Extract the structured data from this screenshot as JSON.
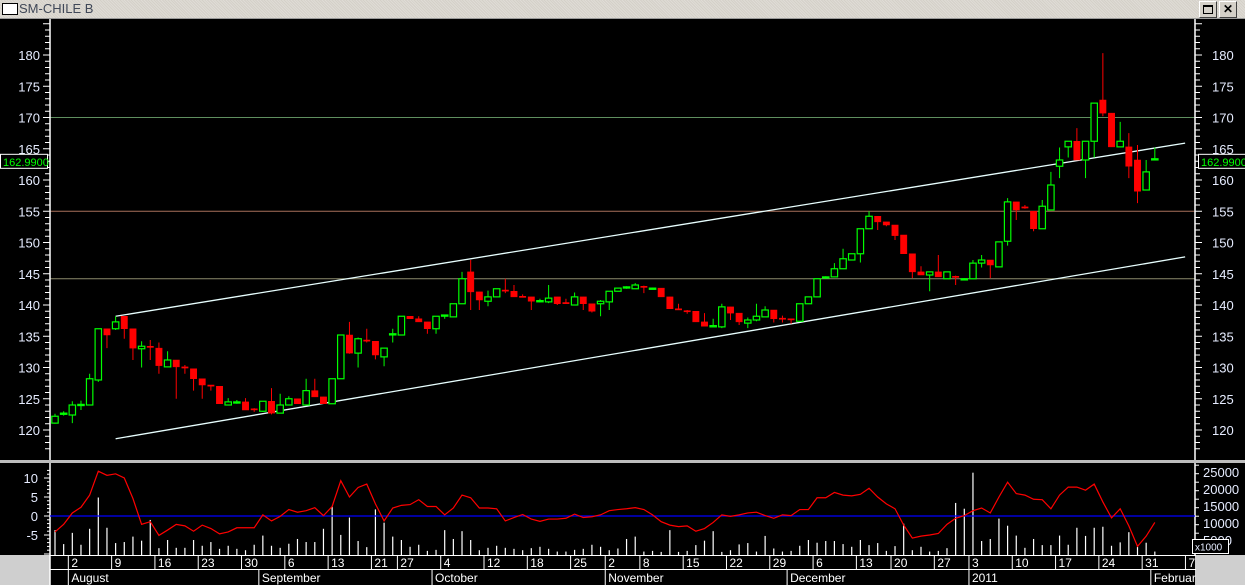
{
  "window": {
    "title": "SM-CHILE B",
    "restore_label": "restore",
    "close_label": "✕"
  },
  "last_price_label": "162.9900",
  "volume_multiplier_label": "x1000",
  "colors": {
    "up": "#00ff00",
    "down": "#ff0000",
    "oscillator": "#ff0000",
    "zero_line": "#0000ff",
    "volume": "#ffffff",
    "trendline": "#e8ffff",
    "axis_text": "#e6ecff"
  },
  "chart_data": [
    {
      "type": "candlestick",
      "title": "SM-CHILE B",
      "ylim": [
        116,
        186
      ],
      "yticks": [
        120,
        125,
        130,
        135,
        140,
        145,
        150,
        155,
        160,
        165,
        170,
        175,
        180
      ],
      "horizontal_lines": [
        {
          "value": 170,
          "color": "#5f8f5f"
        },
        {
          "value": 155,
          "color": "#a8705a"
        },
        {
          "value": 144.2,
          "color": "#8c8a6c"
        }
      ],
      "trendlines": [
        {
          "from": [
            7,
            138.2
          ],
          "to": [
            130.5,
            165.9
          ]
        },
        {
          "from": [
            7,
            118.6
          ],
          "to": [
            130.5,
            147.7
          ]
        }
      ],
      "ohlc": [
        [
          121.1,
          122.6,
          121.0,
          122.2
        ],
        [
          122.7,
          123.0,
          122.3,
          122.7
        ],
        [
          122.4,
          124.6,
          121.1,
          124.0
        ],
        [
          124.0,
          124.7,
          123.2,
          124.1
        ],
        [
          124.0,
          129.0,
          124.0,
          128.2
        ],
        [
          128.0,
          136.2,
          127.7,
          136.2
        ],
        [
          136.2,
          136.2,
          133.1,
          135.2
        ],
        [
          136.2,
          138.2,
          136.0,
          137.3
        ],
        [
          138.2,
          138.2,
          134.6,
          136.2
        ],
        [
          136.2,
          136.2,
          131.2,
          133.1
        ],
        [
          133.0,
          134.2,
          130.0,
          133.4
        ],
        [
          133.4,
          134.4,
          131.2,
          133.3
        ],
        [
          133.1,
          134.0,
          129.0,
          130.3
        ],
        [
          130.1,
          132.6,
          130.1,
          131.2
        ],
        [
          131.2,
          131.2,
          125.0,
          130.1
        ],
        [
          130.1,
          130.4,
          129.0,
          130.0
        ],
        [
          129.8,
          129.8,
          126.3,
          128.2
        ],
        [
          128.2,
          128.2,
          125.0,
          127.2
        ],
        [
          127.2,
          127.2,
          126.3,
          127.1
        ],
        [
          127.0,
          127.0,
          124.2,
          124.2
        ],
        [
          124.0,
          125.1,
          124.0,
          124.5
        ],
        [
          124.4,
          124.8,
          124.2,
          124.5
        ],
        [
          124.5,
          125.1,
          123.2,
          123.2
        ],
        [
          123.4,
          123.5,
          122.9,
          123.3
        ],
        [
          123.0,
          124.6,
          122.9,
          124.6
        ],
        [
          124.6,
          126.7,
          122.5,
          122.7
        ],
        [
          122.7,
          125.8,
          122.7,
          124.0
        ],
        [
          124.0,
          125.4,
          124.0,
          125.0
        ],
        [
          125.0,
          125.0,
          124.2,
          124.2
        ],
        [
          124.0,
          128.2,
          124.0,
          126.3
        ],
        [
          126.3,
          128.2,
          125.3,
          125.3
        ],
        [
          125.3,
          125.3,
          124.2,
          124.2
        ],
        [
          124.2,
          128.2,
          124.2,
          128.2
        ],
        [
          128.2,
          135.2,
          128.2,
          135.2
        ],
        [
          135.2,
          137.3,
          132.2,
          132.3
        ],
        [
          132.3,
          134.8,
          130.0,
          134.6
        ],
        [
          134.4,
          136.2,
          134.0,
          134.3
        ],
        [
          134.2,
          134.2,
          131.3,
          132.0
        ],
        [
          131.7,
          133.1,
          130.2,
          133.1
        ],
        [
          135.3,
          136.2,
          134.0,
          135.4
        ],
        [
          135.2,
          138.2,
          135.2,
          138.2
        ],
        [
          138.2,
          138.2,
          137.8,
          137.8
        ],
        [
          137.8,
          138.2,
          137.3,
          137.3
        ],
        [
          137.3,
          137.3,
          135.4,
          136.2
        ],
        [
          136.2,
          138.2,
          135.4,
          138.2
        ],
        [
          138.3,
          138.4,
          137.8,
          138.4
        ],
        [
          138.1,
          140.2,
          138.1,
          140.2
        ],
        [
          140.2,
          145.3,
          140.2,
          144.2
        ],
        [
          145.3,
          147.2,
          139.2,
          142.1
        ],
        [
          142.1,
          142.1,
          139.2,
          140.8
        ],
        [
          140.6,
          142.3,
          139.8,
          141.3
        ],
        [
          141.3,
          142.6,
          141.3,
          142.6
        ],
        [
          142.4,
          144.2,
          141.9,
          142.3
        ],
        [
          142.2,
          143.2,
          141.3,
          141.3
        ],
        [
          141.4,
          141.7,
          141.3,
          141.3
        ],
        [
          141.3,
          141.3,
          139.2,
          140.6
        ],
        [
          140.6,
          141.0,
          140.4,
          140.7
        ],
        [
          140.5,
          143.2,
          140.3,
          141.1
        ],
        [
          141.3,
          141.3,
          140.0,
          140.2
        ],
        [
          140.4,
          141.0,
          140.2,
          140.3
        ],
        [
          140.0,
          142.0,
          140.0,
          141.3
        ],
        [
          141.3,
          141.3,
          139.2,
          140.2
        ],
        [
          140.2,
          140.2,
          138.8,
          139.0
        ],
        [
          140.2,
          140.8,
          138.2,
          140.6
        ],
        [
          140.5,
          142.2,
          139.2,
          142.2
        ],
        [
          142.2,
          142.7,
          142.2,
          142.7
        ],
        [
          142.8,
          143.0,
          142.6,
          142.9
        ],
        [
          142.6,
          143.5,
          142.6,
          143.2
        ],
        [
          143.0,
          143.1,
          141.9,
          142.9
        ],
        [
          142.7,
          142.8,
          142.6,
          142.7
        ],
        [
          142.7,
          142.7,
          141.3,
          141.3
        ],
        [
          141.3,
          141.3,
          139.4,
          139.4
        ],
        [
          139.4,
          140.2,
          139.2,
          139.3
        ],
        [
          139.1,
          139.2,
          138.6,
          139.0
        ],
        [
          139.0,
          139.0,
          137.3,
          137.3
        ],
        [
          137.3,
          138.7,
          136.6,
          136.6
        ],
        [
          136.5,
          137.8,
          136.5,
          136.7
        ],
        [
          136.5,
          140.2,
          136.3,
          139.7
        ],
        [
          139.7,
          139.7,
          137.6,
          138.7
        ],
        [
          138.7,
          138.7,
          136.8,
          137.3
        ],
        [
          137.1,
          138.0,
          136.3,
          137.6
        ],
        [
          137.6,
          140.2,
          137.4,
          138.2
        ],
        [
          138.1,
          139.8,
          138.1,
          139.2
        ],
        [
          139.2,
          139.2,
          137.2,
          137.8
        ],
        [
          137.9,
          138.3,
          137.2,
          137.8
        ],
        [
          137.8,
          137.8,
          137.0,
          137.7
        ],
        [
          137.4,
          140.2,
          137.4,
          140.2
        ],
        [
          140.2,
          141.3,
          140.2,
          141.3
        ],
        [
          141.3,
          144.2,
          141.3,
          144.2
        ],
        [
          144.4,
          144.6,
          144.3,
          144.5
        ],
        [
          144.5,
          146.7,
          144.5,
          145.8
        ],
        [
          145.8,
          149.0,
          145.8,
          147.4
        ],
        [
          147.2,
          148.2,
          147.2,
          148.2
        ],
        [
          148.2,
          152.2,
          146.8,
          152.2
        ],
        [
          152.2,
          155.0,
          152.2,
          154.2
        ],
        [
          154.2,
          154.2,
          152.0,
          153.3
        ],
        [
          153.3,
          153.3,
          152.6,
          152.8
        ],
        [
          152.8,
          152.8,
          150.4,
          151.1
        ],
        [
          151.2,
          151.2,
          148.2,
          148.2
        ],
        [
          148.2,
          148.2,
          144.3,
          145.3
        ],
        [
          145.3,
          146.2,
          144.8,
          144.8
        ],
        [
          144.8,
          145.3,
          142.2,
          145.3
        ],
        [
          145.3,
          148.0,
          144.5,
          144.5
        ],
        [
          144.2,
          145.3,
          144.2,
          145.3
        ],
        [
          144.6,
          144.7,
          143.2,
          144.5
        ],
        [
          144.2,
          144.3,
          144.1,
          144.2
        ],
        [
          144.2,
          147.2,
          144.2,
          146.7
        ],
        [
          146.7,
          148.0,
          146.0,
          147.2
        ],
        [
          147.2,
          147.2,
          144.3,
          146.4
        ],
        [
          146.1,
          150.1,
          146.1,
          150.1
        ],
        [
          150.2,
          157.1,
          149.5,
          156.5
        ],
        [
          156.5,
          156.5,
          153.6,
          155.2
        ],
        [
          155.7,
          156.0,
          155.4,
          155.6
        ],
        [
          155.0,
          155.0,
          151.8,
          152.2
        ],
        [
          152.2,
          156.8,
          152.2,
          155.8
        ],
        [
          155.2,
          161.3,
          155.2,
          159.2
        ],
        [
          162.2,
          165.2,
          160.3,
          163.2
        ],
        [
          165.3,
          166.2,
          163.6,
          166.2
        ],
        [
          166.2,
          168.3,
          163.2,
          163.2
        ],
        [
          163.2,
          166.2,
          160.3,
          166.2
        ],
        [
          166.2,
          172.3,
          163.6,
          172.3
        ],
        [
          172.8,
          180.3,
          170.2,
          170.7
        ],
        [
          170.7,
          170.7,
          165.3,
          165.3
        ],
        [
          165.3,
          169.3,
          165.3,
          166.2
        ],
        [
          165.3,
          167.5,
          160.3,
          162.2
        ],
        [
          163.2,
          165.6,
          156.3,
          158.2
        ],
        [
          158.4,
          163.2,
          158.4,
          161.3
        ],
        [
          163.4,
          165.2,
          163.4,
          163.4
        ]
      ]
    },
    {
      "type": "line+bar",
      "oscillator": {
        "ylim": [
          -10,
          14
        ],
        "yticks": [
          -5,
          0,
          5,
          10
        ],
        "values": [
          -4.2,
          -2.2,
          0.8,
          2.3,
          5.5,
          11.8,
          10.7,
          11.1,
          10,
          4.6,
          -2.2,
          -1.5,
          -5.1,
          -3.7,
          -2.2,
          -2.6,
          -4,
          -2.4,
          -3.3,
          -4.7,
          -4.2,
          -3.1,
          -3.1,
          -3.1,
          0.3,
          -1.3,
          -0.1,
          1.7,
          1,
          1.4,
          2.2,
          0.1,
          2.5,
          9.3,
          5,
          7.5,
          8.4,
          3.2,
          -1.3,
          2.1,
          2.8,
          3,
          4.3,
          2.5,
          2.5,
          0.3,
          2.1,
          5.5,
          4.8,
          2.1,
          2.1,
          1.9,
          -1.3,
          -0.4,
          0.4,
          -0.8,
          -1.4,
          -0.8,
          -0.8,
          -0.6,
          0.5,
          -0.4,
          -0.2,
          0.3,
          1.4,
          1.7,
          1.9,
          2.2,
          1.7,
          0.3,
          -1.5,
          -2.4,
          -2.8,
          -2.6,
          -4,
          -3.3,
          -1.7,
          0.3,
          -0.1,
          0.3,
          0.8,
          1,
          0.1,
          -0.6,
          0.3,
          0.1,
          1.7,
          1.7,
          4.8,
          4.8,
          6.2,
          5.5,
          5.3,
          5.7,
          7.3,
          5,
          3.2,
          1.9,
          -2.4,
          -5.8,
          -5.3,
          -5,
          -4.6,
          -2.2,
          -0.6,
          0.1,
          1.4,
          2.1,
          0.8,
          5,
          8.9,
          5.9,
          5.5,
          4.4,
          4.3,
          1.9,
          5.5,
          7.6,
          7.6,
          6.8,
          8.4,
          3.7,
          -0.5,
          1.9,
          -2.6,
          -8,
          -5.3,
          -1.7
        ]
      },
      "volume": {
        "unit": "x1000",
        "ylim": [
          0,
          28
        ],
        "yticks": [
          5000,
          10000,
          15000,
          20000,
          25000
        ],
        "values": [
          7.9,
          3.8,
          7.1,
          3.6,
          8.3,
          17.5,
          8.6,
          4.1,
          4.4,
          6,
          4.8,
          10.9,
          2.6,
          5,
          2.7,
          2.7,
          5,
          3.3,
          4.4,
          2.4,
          3.3,
          2.4,
          2,
          3.6,
          6.3,
          3.3,
          2.7,
          3.9,
          5.3,
          4.4,
          4.4,
          8.3,
          14.8,
          6.5,
          11.6,
          4.7,
          2.9,
          14,
          10.1,
          6,
          5,
          3,
          3.6,
          1.8,
          2.1,
          7.9,
          5.3,
          7.6,
          5,
          2,
          2.7,
          3.3,
          2.7,
          2.4,
          2,
          2.6,
          3,
          2.4,
          1.6,
          1.6,
          2.1,
          2.4,
          3.6,
          3,
          2.0,
          2.5,
          5.3,
          6,
          1.6,
          1.8,
          1.5,
          7.9,
          1.5,
          1.8,
          3.5,
          4.8,
          7.6,
          1.5,
          2,
          3.7,
          4.1,
          1.6,
          6.2,
          2.5,
          1.6,
          1.8,
          3.3,
          5,
          4.2,
          4.7,
          4.7,
          3.8,
          3,
          5,
          3.5,
          4.1,
          1.8,
          3.2,
          9.8,
          2,
          3,
          1.6,
          1.8,
          2.6,
          15.9,
          14.2,
          24.8,
          4.7,
          5.3,
          11.3,
          9.2,
          6.3,
          2.7,
          5.3,
          3.5,
          3.5,
          6.3,
          3.6,
          8.6,
          6.2,
          8.6,
          8.9,
          3.3,
          4.3,
          7.3,
          3,
          4.2,
          1.6
        ]
      }
    }
  ],
  "x_axis": {
    "days": [
      {
        "label": "2",
        "index": 2
      },
      {
        "label": "9",
        "index": 7
      },
      {
        "label": "16",
        "index": 12
      },
      {
        "label": "23",
        "index": 17
      },
      {
        "label": "30",
        "index": 22
      },
      {
        "label": "6",
        "index": 27
      },
      {
        "label": "13",
        "index": 32
      },
      {
        "label": "21",
        "index": 37
      },
      {
        "label": "27",
        "index": 40
      },
      {
        "label": "4",
        "index": 45
      },
      {
        "label": "12",
        "index": 50
      },
      {
        "label": "18",
        "index": 55
      },
      {
        "label": "25",
        "index": 60
      },
      {
        "label": "2",
        "index": 64
      },
      {
        "label": "8",
        "index": 68
      },
      {
        "label": "15",
        "index": 73
      },
      {
        "label": "22",
        "index": 78
      },
      {
        "label": "29",
        "index": 83
      },
      {
        "label": "6",
        "index": 88
      },
      {
        "label": "13",
        "index": 93
      },
      {
        "label": "20",
        "index": 97
      },
      {
        "label": "27",
        "index": 102
      },
      {
        "label": "3",
        "index": 106
      },
      {
        "label": "10",
        "index": 111
      },
      {
        "label": "17",
        "index": 116
      },
      {
        "label": "24",
        "index": 121
      },
      {
        "label": "31",
        "index": 126
      },
      {
        "label": "7",
        "index": 131
      }
    ],
    "months": [
      {
        "label": "August",
        "index": 2
      },
      {
        "label": "September",
        "index": 24
      },
      {
        "label": "October",
        "index": 44
      },
      {
        "label": "November",
        "index": 64
      },
      {
        "label": "December",
        "index": 85
      },
      {
        "label": "2011",
        "index": 106
      },
      {
        "label": "February",
        "index": 127
      }
    ]
  }
}
